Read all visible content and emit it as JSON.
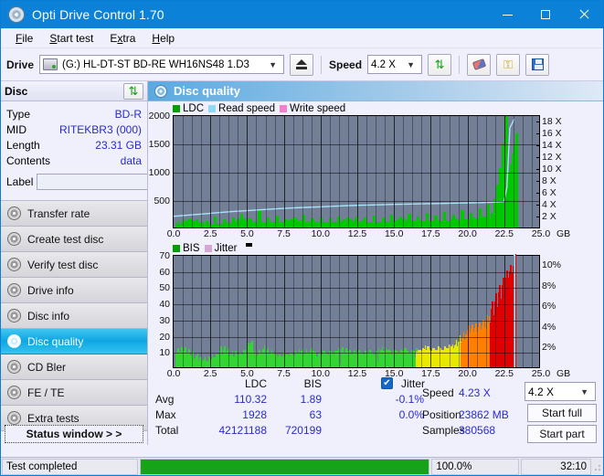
{
  "window": {
    "title": "Opti Drive Control 1.70",
    "app_icon": "disc-icon",
    "minimize": "–",
    "maximize": "□",
    "close": "✕",
    "accent": "#0b82d8"
  },
  "menu": [
    {
      "label": "File",
      "accel": "F"
    },
    {
      "label": "Start test",
      "accel": "S"
    },
    {
      "label": "Extra",
      "accel": "x"
    },
    {
      "label": "Help",
      "accel": "H"
    }
  ],
  "toolbar": {
    "drive_label": "Drive",
    "drive_value": "(G:)  HL-DT-ST BD-RE  WH16NS48 1.D3",
    "eject_title": "eject",
    "speed_label": "Speed",
    "speed_value": "4.2 X",
    "refresh_title": "refresh",
    "erase_title": "erase",
    "keys_title": "keys",
    "save_title": "save"
  },
  "disc": {
    "header": "Disc",
    "refresh_icon": "refresh-icon",
    "rows": [
      {
        "key": "Type",
        "value": "BD-R"
      },
      {
        "key": "MID",
        "value": "RITEKBR3 (000)"
      },
      {
        "key": "Length",
        "value": "23.31 GB"
      },
      {
        "key": "Contents",
        "value": "data"
      }
    ],
    "label_key": "Label",
    "label_value": "",
    "label_placeholder": "",
    "cd_icon": "disc-icon"
  },
  "nav": {
    "items": [
      {
        "label": "Transfer rate",
        "active": false
      },
      {
        "label": "Create test disc",
        "active": false
      },
      {
        "label": "Verify test disc",
        "active": false
      },
      {
        "label": "Drive info",
        "active": false
      },
      {
        "label": "Disc info",
        "active": false
      },
      {
        "label": "Disc quality",
        "active": true
      },
      {
        "label": "CD Bler",
        "active": false
      },
      {
        "label": "FE / TE",
        "active": false
      },
      {
        "label": "Extra tests",
        "active": false
      }
    ],
    "status_window": "Status window > >"
  },
  "panel": {
    "title": "Disc quality",
    "icon": "disc-quality-icon"
  },
  "chart_data": [
    {
      "type": "bar",
      "id": "ldc-chart",
      "title": "",
      "xlabel": "GB",
      "ylabel": "LDC",
      "legend": [
        {
          "label": "LDC",
          "color": "#00a000"
        },
        {
          "label": "Read speed",
          "color": "#8ed8f8"
        },
        {
          "label": "Write speed",
          "color": "#f47fd0"
        }
      ],
      "xlim": [
        0,
        25
      ],
      "xticks": [
        "0.0",
        "2.5",
        "5.0",
        "7.5",
        "10.0",
        "12.5",
        "15.0",
        "17.5",
        "20.0",
        "22.5",
        "25.0"
      ],
      "xunit": "GB",
      "ylim": [
        0,
        2000
      ],
      "yticks": [
        500,
        1000,
        1500,
        2000
      ],
      "y2lim": [
        0,
        19
      ],
      "y2ticks": [
        "2 X",
        "4 X",
        "6 X",
        "8 X",
        "10 X",
        "12 X",
        "14 X",
        "16 X",
        "18 X"
      ],
      "grid": true,
      "series": [
        {
          "name": "LDC",
          "color": "#00c800",
          "x": [
            0.15,
            0.35,
            0.55,
            0.75,
            0.95,
            1.15,
            1.35,
            1.55,
            1.75,
            1.95,
            2.15,
            2.35,
            2.55,
            2.75,
            2.95,
            3.15,
            3.35,
            3.55,
            3.75,
            3.95,
            4.15,
            4.35,
            4.55,
            4.75,
            4.95,
            5.15,
            5.35,
            5.55,
            5.75,
            5.95,
            6.15,
            6.35,
            6.55,
            6.75,
            6.95,
            7.15,
            7.35,
            7.55,
            7.75,
            7.95,
            8.15,
            8.35,
            8.55,
            8.75,
            8.95,
            9.15,
            9.35,
            9.55,
            9.75,
            9.95,
            10.15,
            10.35,
            10.55,
            10.75,
            10.95,
            11.15,
            11.35,
            11.55,
            11.75,
            11.95,
            12.15,
            12.35,
            12.55,
            12.75,
            12.95,
            13.15,
            13.35,
            13.55,
            13.75,
            13.95,
            14.15,
            14.35,
            14.55,
            14.75,
            14.95,
            15.15,
            15.35,
            15.55,
            15.75,
            15.95,
            16.15,
            16.35,
            16.55,
            16.75,
            16.95,
            17.15,
            17.35,
            17.55,
            17.75,
            17.95,
            18.15,
            18.35,
            18.55,
            18.75,
            18.95,
            19.15,
            19.35,
            19.55,
            19.75,
            19.95,
            20.15,
            20.35,
            20.55,
            20.75,
            20.95,
            21.15,
            21.35,
            21.55,
            21.75,
            21.95,
            22.15,
            22.35,
            22.55,
            22.75,
            22.95,
            23.1,
            23.2,
            23.3
          ],
          "values": [
            12,
            20,
            18,
            30,
            26,
            70,
            35,
            28,
            60,
            42,
            120,
            55,
            48,
            200,
            62,
            58,
            140,
            70,
            66,
            180,
            75,
            70,
            250,
            85,
            78,
            160,
            90,
            84,
            300,
            95,
            88,
            175,
            96,
            92,
            210,
            98,
            94,
            150,
            96,
            92,
            170,
            94,
            90,
            230,
            96,
            92,
            160,
            94,
            90,
            185,
            95,
            92,
            165,
            96,
            92,
            200,
            98,
            94,
            170,
            96,
            92,
            190,
            98,
            95,
            175,
            100,
            96,
            215,
            102,
            98,
            180,
            104,
            100,
            230,
            106,
            102,
            190,
            108,
            104,
            240,
            112,
            106,
            200,
            115,
            110,
            260,
            120,
            115,
            210,
            125,
            120,
            280,
            130,
            125,
            230,
            140,
            135,
            300,
            150,
            145,
            260,
            170,
            160,
            340,
            200,
            190,
            420,
            260,
            520,
            760,
            1050,
            1480,
            1960,
            40
          ]
        },
        {
          "name": "Read speed",
          "color": "#9bdcf8",
          "x": [
            0.0,
            1.0,
            2.0,
            3.0,
            4.0,
            5.0,
            6.0,
            7.0,
            8.0,
            9.0,
            10.0,
            11.0,
            12.0,
            13.0,
            14.0,
            15.0,
            16.0,
            17.0,
            18.0,
            19.0,
            20.0,
            21.0,
            22.0,
            22.6,
            22.8,
            22.9,
            23.0,
            23.3
          ],
          "values_x": [
            2.1,
            2.3,
            2.5,
            2.7,
            2.9,
            3.05,
            3.2,
            3.35,
            3.5,
            3.6,
            3.7,
            3.8,
            3.9,
            3.97,
            4.03,
            4.1,
            4.15,
            4.2,
            4.25,
            4.3,
            4.35,
            4.4,
            4.5,
            4.6,
            7.0,
            12.0,
            17.0,
            18.5
          ]
        }
      ]
    },
    {
      "type": "bar",
      "id": "bis-chart",
      "title": "",
      "xlabel": "GB",
      "ylabel": "BIS",
      "legend": [
        {
          "label": "BIS",
          "color": "#00a000"
        },
        {
          "label": "Jitter",
          "color": "#d6a6d6"
        }
      ],
      "xlim": [
        0,
        25
      ],
      "xticks": [
        "0.0",
        "2.5",
        "5.0",
        "7.5",
        "10.0",
        "12.5",
        "15.0",
        "17.5",
        "20.0",
        "22.5",
        "25.0"
      ],
      "xunit": "GB",
      "ylim": [
        0,
        70
      ],
      "yticks": [
        10,
        20,
        30,
        40,
        50,
        60,
        70
      ],
      "y2lim": [
        0,
        11
      ],
      "y2ticks": [
        "2%",
        "4%",
        "6%",
        "8%",
        "10%"
      ],
      "grid": true,
      "series": [
        {
          "name": "BIS",
          "color_low": "#35d435",
          "color_mid": "#e8e800",
          "color_high": "#ff8000",
          "color_max": "#e00000",
          "x": [
            0.1,
            0.25,
            0.4,
            0.55,
            0.7,
            0.85,
            1.0,
            1.15,
            1.3,
            1.45,
            1.6,
            1.75,
            1.9,
            2.05,
            2.2,
            2.35,
            2.5,
            2.65,
            2.8,
            2.95,
            3.1,
            3.25,
            3.4,
            3.55,
            3.7,
            3.85,
            4.0,
            4.15,
            4.3,
            4.45,
            4.6,
            4.75,
            4.9,
            5.0,
            5.1,
            5.2,
            5.35,
            5.5,
            5.65,
            5.8,
            5.95,
            6.1,
            6.25,
            6.4,
            6.55,
            6.7,
            6.85,
            7.0,
            7.15,
            7.3,
            7.45,
            7.6,
            7.75,
            7.9,
            8.05,
            8.2,
            8.35,
            8.5,
            8.65,
            8.8,
            8.95,
            9.1,
            9.25,
            9.4,
            9.55,
            9.7,
            9.85,
            10.0,
            10.15,
            10.3,
            10.45,
            10.6,
            10.75,
            10.9,
            11.05,
            11.2,
            11.35,
            11.5,
            11.65,
            11.8,
            11.95,
            12.1,
            12.25,
            12.4,
            12.55,
            12.7,
            12.85,
            13.0,
            13.15,
            13.3,
            13.45,
            13.6,
            13.75,
            13.9,
            14.05,
            14.2,
            14.35,
            14.5,
            14.65,
            14.8,
            14.95,
            15.1,
            15.25,
            15.4,
            15.55,
            15.7,
            15.85,
            16.0,
            16.15,
            16.3,
            16.45,
            16.6,
            16.75,
            16.9,
            17.05,
            17.2,
            17.35,
            17.5,
            17.65,
            17.8,
            17.95,
            18.1,
            18.25,
            18.4,
            18.55,
            18.7,
            18.85,
            19.0,
            19.15,
            19.3,
            19.45,
            19.6,
            19.75,
            19.9,
            20.05,
            20.2,
            20.35,
            20.5,
            20.65,
            20.8,
            20.95,
            21.1,
            21.25,
            21.4,
            21.55,
            21.7,
            21.85,
            22.0,
            22.15,
            22.3,
            22.45,
            22.6,
            22.75,
            22.85,
            22.95,
            23.05,
            23.2
          ],
          "values": [
            2,
            3,
            2,
            4,
            3,
            2,
            4,
            3,
            5,
            3,
            4,
            6,
            4,
            5,
            4,
            7,
            5,
            6,
            5,
            8,
            6,
            7,
            6,
            9,
            7,
            8,
            7,
            10,
            8,
            9,
            8,
            11,
            9,
            10,
            14,
            15,
            10,
            8,
            7,
            9,
            8,
            7,
            9,
            8,
            7,
            9,
            8,
            7,
            8,
            7,
            9,
            8,
            7,
            9,
            8,
            7,
            9,
            8,
            10,
            8,
            7,
            9,
            8,
            10,
            8,
            7,
            9,
            8,
            10,
            9,
            8,
            10,
            9,
            8,
            10,
            9,
            11,
            9,
            8,
            10,
            9,
            8,
            10,
            9,
            11,
            9,
            8,
            10,
            9,
            11,
            9,
            8,
            10,
            9,
            11,
            10,
            9,
            11,
            10,
            9,
            11,
            10,
            9,
            11,
            10,
            12,
            10,
            9,
            11,
            10,
            12,
            11,
            10,
            12,
            11,
            13,
            11,
            10,
            12,
            11,
            13,
            12,
            11,
            13,
            12,
            14,
            13,
            12,
            14,
            13,
            16,
            14,
            13,
            17,
            15,
            14,
            18,
            16,
            15,
            20,
            18,
            17,
            22,
            20,
            19,
            25,
            23,
            21,
            28,
            26,
            24,
            32,
            30,
            28,
            36,
            34,
            40,
            48,
            62,
            4
          ]
        }
      ]
    }
  ],
  "stats": {
    "columns": [
      "LDC",
      "BIS"
    ],
    "rows": [
      {
        "label": "Avg",
        "ldc": "110.32",
        "bis": "1.89",
        "jitter": "-0.1%"
      },
      {
        "label": "Max",
        "ldc": "1928",
        "bis": "63",
        "jitter": "0.0%"
      },
      {
        "label": "Total",
        "ldc": "42121188",
        "bis": "720199",
        "jitter": ""
      }
    ],
    "jitter_label": "Jitter",
    "jitter_checked": true,
    "speed_label": "Speed",
    "speed_value": "4.23 X",
    "position_label": "Position",
    "position_value": "23862 MB",
    "samples_label": "Samples",
    "samples_value": "380568",
    "speed_select": "4.2 X",
    "start_full": "Start full",
    "start_part": "Start part"
  },
  "statusbar": {
    "message": "Test completed",
    "progress_pct": 100.0,
    "progress_text": "100.0%",
    "elapsed": "32:10",
    "progress_color": "#17a317"
  }
}
